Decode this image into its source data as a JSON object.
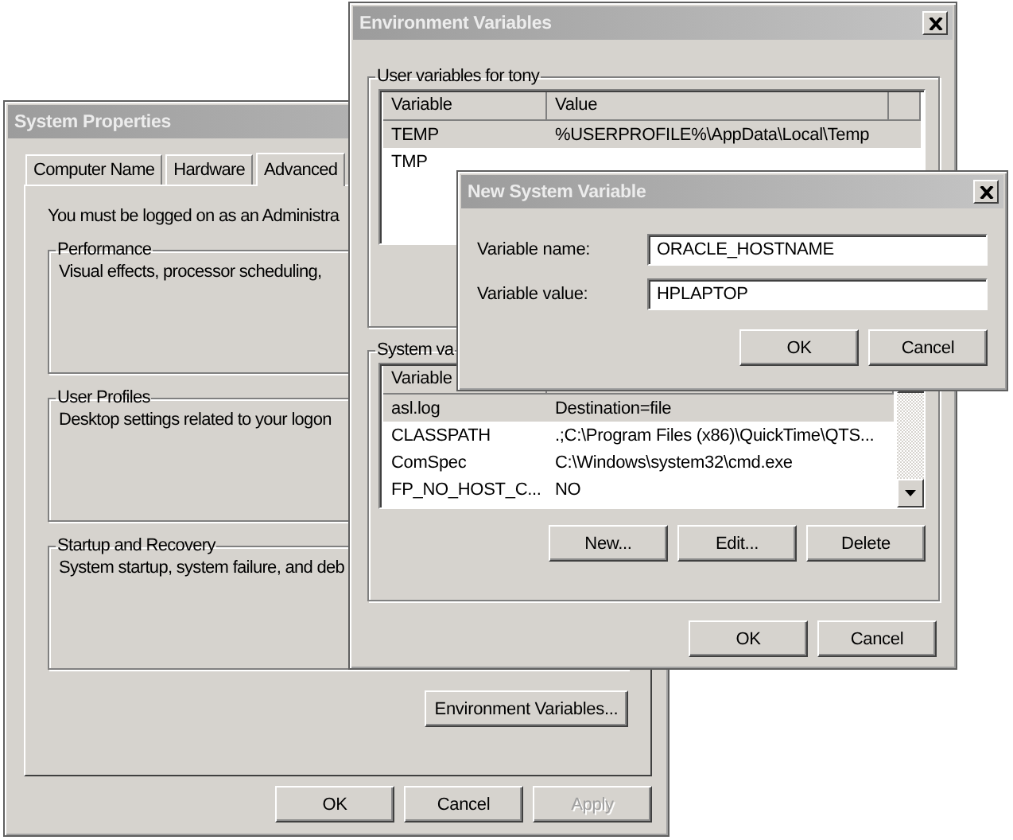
{
  "system_properties": {
    "title": "System Properties",
    "tabs": [
      {
        "label": "Computer Name",
        "selected": false
      },
      {
        "label": "Hardware",
        "selected": false
      },
      {
        "label": "Advanced",
        "selected": true
      }
    ],
    "notice": "You must be logged on as an Administra",
    "groups": [
      {
        "label": "Performance",
        "text": "Visual effects, processor scheduling,"
      },
      {
        "label": "User Profiles",
        "text": "Desktop settings related to your logon"
      },
      {
        "label": "Startup and Recovery",
        "text": "System startup, system failure, and deb"
      }
    ],
    "environment_button": "Environment Variables...",
    "buttons": [
      {
        "label": "OK",
        "disabled": false
      },
      {
        "label": "Cancel",
        "disabled": false
      },
      {
        "label": "Apply",
        "disabled": true
      }
    ]
  },
  "environment_variables": {
    "title": "Environment Variables",
    "user_group": {
      "label": "User variables for tony",
      "columns": [
        "Variable",
        "Value"
      ],
      "rows": [
        {
          "variable": "TEMP",
          "value": "%USERPROFILE%\\AppData\\Local\\Temp",
          "selected": true
        },
        {
          "variable": "TMP",
          "selected": false
        }
      ]
    },
    "system_group": {
      "label": "System va",
      "columns": [
        "Variable"
      ],
      "rows": [
        {
          "variable": "asl.log",
          "value": "Destination=file",
          "selected": true
        },
        {
          "variable": "CLASSPATH",
          "value": ".;C:\\Program Files (x86)\\QuickTime\\QTS...",
          "selected": false
        },
        {
          "variable": "ComSpec",
          "value": "C:\\Windows\\system32\\cmd.exe",
          "selected": false
        },
        {
          "variable": "FP_NO_HOST_C...",
          "value": "NO",
          "selected": false
        }
      ],
      "buttons": [
        "New...",
        "Edit...",
        "Delete"
      ]
    },
    "buttons": [
      "OK",
      "Cancel"
    ]
  },
  "new_system_variable": {
    "title": "New System Variable",
    "fields": [
      {
        "label": "Variable name:",
        "value": "ORACLE_HOSTNAME"
      },
      {
        "label": "Variable value:",
        "value": "HPLAPTOP"
      }
    ],
    "buttons": [
      "OK",
      "Cancel"
    ]
  }
}
